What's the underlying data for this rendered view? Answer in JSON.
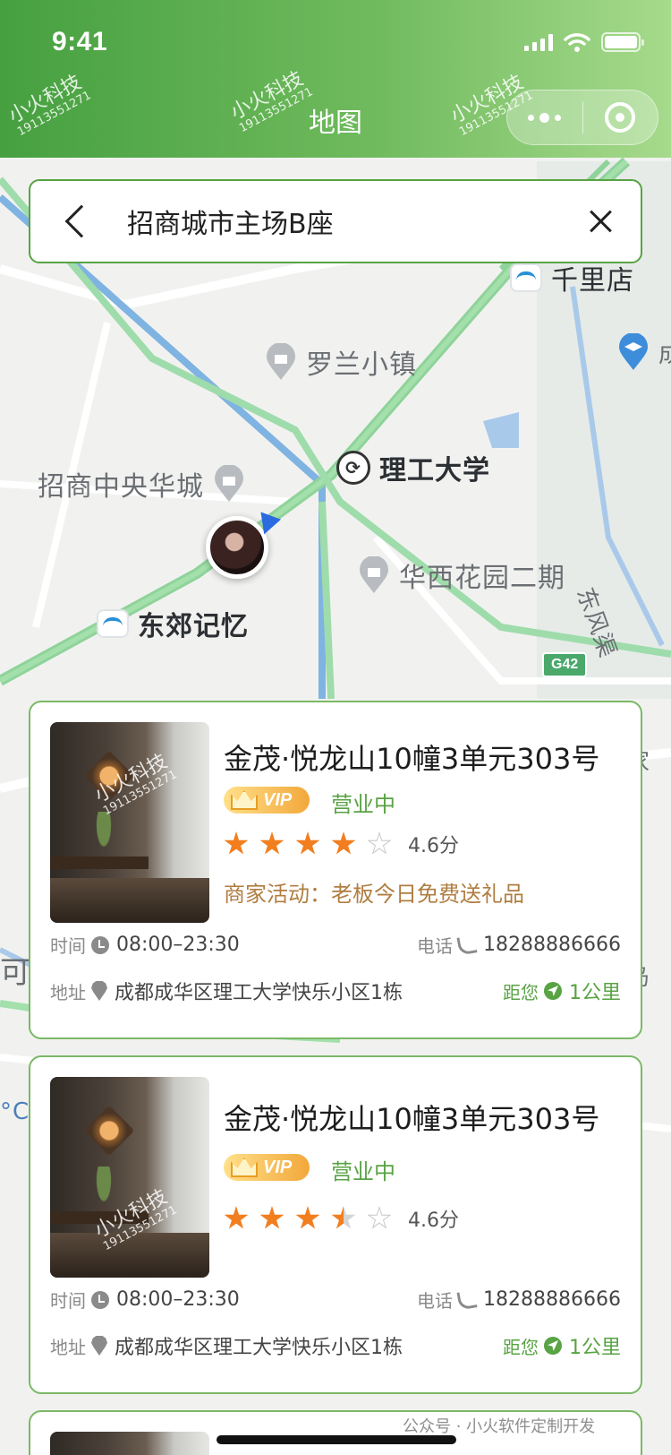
{
  "status_bar": {
    "time": "9:41"
  },
  "nav": {
    "title": "地图"
  },
  "watermark": {
    "brand": "小火科技",
    "phone": "19113551271"
  },
  "search": {
    "value": "招商城市主场B座"
  },
  "map": {
    "pois": {
      "qianli": "千里店",
      "luolan": "罗兰小镇",
      "zhaoshang": "招商中央华城",
      "ligong": "理工大学",
      "huaxi": "华西花园二期",
      "dongjiao": "东郊记忆",
      "dongfeng": "东风渠",
      "edge_right_1": "成",
      "edge_right_2": "家",
      "edge_right_3": "岛",
      "edge_left_1": "可",
      "edge_left_2": "°C"
    },
    "highway": "G42"
  },
  "cards": [
    {
      "title": "金茂·悦龙山10幢3单元303号",
      "vip": "VIP",
      "status": "营业中",
      "rating": 4.6,
      "score_text": "4.6分",
      "promo": "商家活动：老板今日免费送礼品",
      "time_label": "时间",
      "hours": "08:00–23:30",
      "phone_label": "电话",
      "phone": "18288886666",
      "address_label": "地址",
      "address": "成都成华区理工大学快乐小区1栋",
      "distance_label": "距您",
      "distance": "1公里"
    },
    {
      "title": "金茂·悦龙山10幢3单元303号",
      "vip": "VIP",
      "status": "营业中",
      "rating": 3.5,
      "score_text": "4.6分",
      "time_label": "时间",
      "hours": "08:00–23:30",
      "phone_label": "电话",
      "phone": "18288886666",
      "address_label": "地址",
      "address": "成都成华区理工大学快乐小区1栋",
      "distance_label": "距您",
      "distance": "1公里"
    }
  ],
  "footer": {
    "watermark": "公众号 · 小火软件定制开发"
  }
}
